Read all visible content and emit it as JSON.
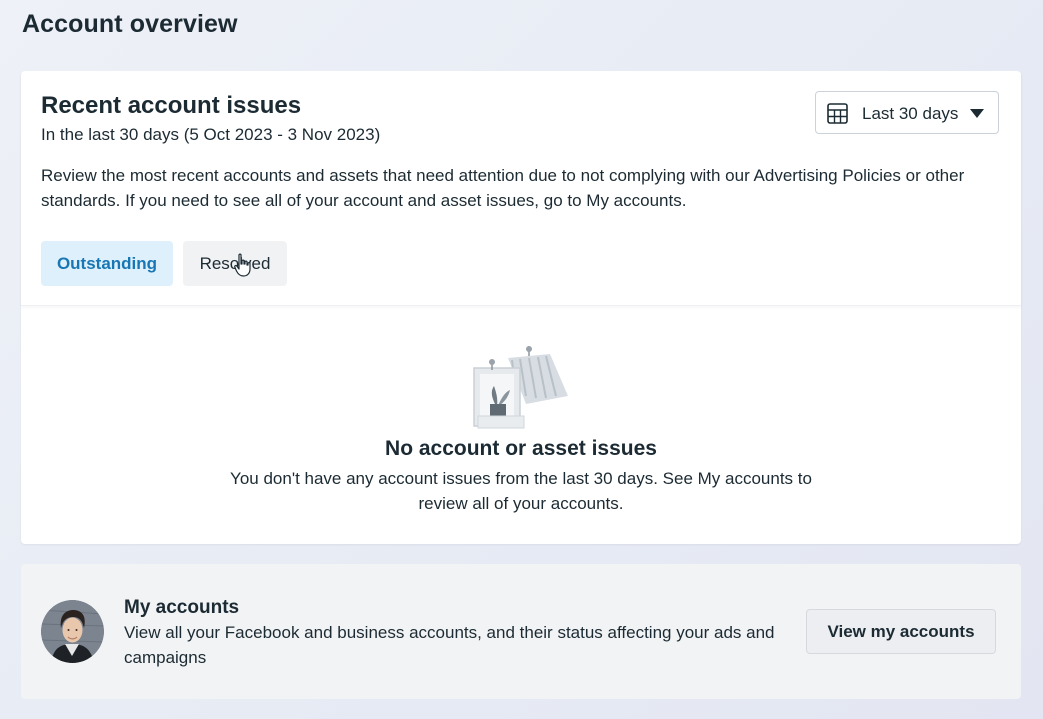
{
  "page": {
    "title": "Account overview"
  },
  "issues_card": {
    "title": "Recent account issues",
    "subtitle": "In the last 30 days (5 Oct 2023 - 3 Nov 2023)",
    "description": "Review the most recent accounts and assets that need attention due to not complying with our Advertising Policies or other standards. If you need to see all of your account and asset issues, go to My accounts.",
    "date_range": {
      "icon": "calendar-table-icon",
      "selected": "Last 30 days",
      "caret_icon": "caret-down-icon"
    },
    "tabs": [
      {
        "label": "Outstanding",
        "active": true
      },
      {
        "label": "Resolved",
        "active": false
      }
    ],
    "empty_state": {
      "illustration": "empty-boxes-illustration",
      "title": "No account or asset issues",
      "description": "You don't have any account issues from the last 30 days. See My accounts to review all of your accounts."
    }
  },
  "my_accounts": {
    "avatar": "user-avatar",
    "title": "My accounts",
    "description": "View all your Facebook and business accounts, and their status affecting your ads and campaigns",
    "button_label": "View my accounts"
  },
  "colors": {
    "active_tab_bg": "#def0fb",
    "active_tab_text": "#1876b5",
    "text_primary": "#1c2b33",
    "card_bg": "#ffffff",
    "accounts_card_bg": "#f2f3f5"
  }
}
